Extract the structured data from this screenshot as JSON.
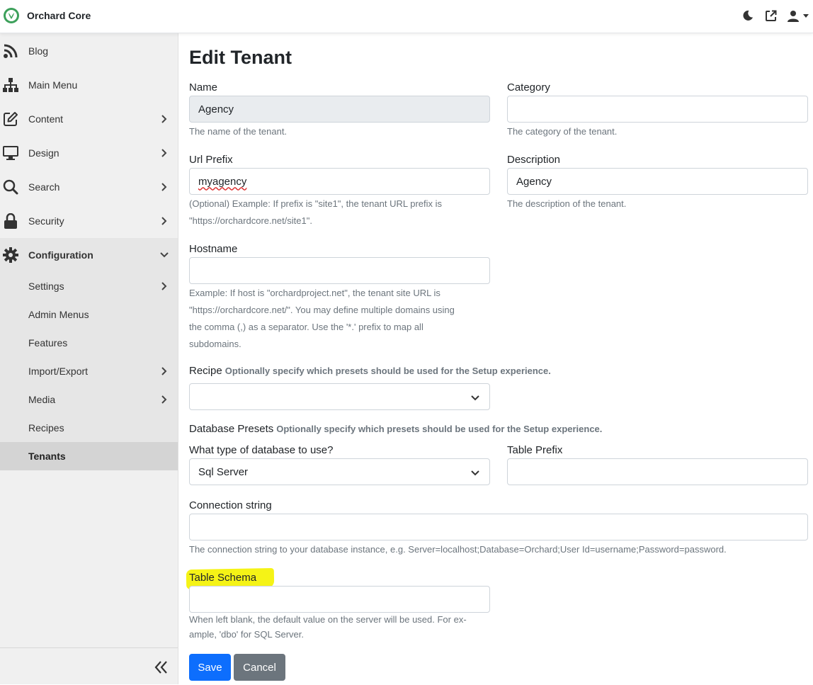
{
  "app": {
    "title": "Orchard Core"
  },
  "topbar": {
    "icons": [
      "moon-icon",
      "external-link-icon",
      "user-icon"
    ]
  },
  "sidebar": {
    "items": [
      {
        "label": "Blog",
        "icon": "rss-icon",
        "has_children": false
      },
      {
        "label": "Main Menu",
        "icon": "sitemap-icon",
        "has_children": false
      },
      {
        "label": "Content",
        "icon": "edit-icon",
        "has_children": true
      },
      {
        "label": "Design",
        "icon": "monitor-icon",
        "has_children": true
      },
      {
        "label": "Search",
        "icon": "search-icon",
        "has_children": true
      },
      {
        "label": "Security",
        "icon": "lock-icon",
        "has_children": true
      },
      {
        "label": "Configuration",
        "icon": "gear-icon",
        "has_children": true,
        "expanded": true
      }
    ],
    "subitems": [
      {
        "label": "Settings",
        "has_children": true
      },
      {
        "label": "Admin Menus",
        "has_children": false
      },
      {
        "label": "Features",
        "has_children": false
      },
      {
        "label": "Import/Export",
        "has_children": true
      },
      {
        "label": "Media",
        "has_children": true
      },
      {
        "label": "Recipes",
        "has_children": false
      },
      {
        "label": "Tenants",
        "has_children": false,
        "active": true
      }
    ]
  },
  "page": {
    "title": "Edit Tenant"
  },
  "form": {
    "name": {
      "label": "Name",
      "value": "Agency",
      "help": "The name of the tenant."
    },
    "category": {
      "label": "Category",
      "value": "",
      "help": "The category of the tenant."
    },
    "url_prefix": {
      "label": "Url Prefix",
      "value": "myagency",
      "help_line1": "(Optional) Example: If prefix is \"site1\", the tenant URL prefix is",
      "help_line2": "\"https://orchardcore.net/site1\"."
    },
    "description": {
      "label": "Description",
      "value": "Agency",
      "help": "The description of the tenant."
    },
    "hostname": {
      "label": "Hostname",
      "value": "",
      "help_lines": [
        "Example: If host is \"orchardproject.net\", the tenant site URL is",
        "\"https://orchardcore.net/\". You may define multiple domains using",
        "the comma (,) as a separator. Use the '*.' prefix to map all",
        "subdomains."
      ]
    },
    "recipe": {
      "label": "Recipe",
      "hint": "Optionally specify which presets should be used for the Setup experience.",
      "selected": ""
    },
    "database_presets": {
      "label": "Database Presets",
      "hint": "Optionally specify which presets should be used for the Setup experience."
    },
    "database_type": {
      "label": "What type of database to use?",
      "selected": "Sql Server"
    },
    "table_prefix": {
      "label": "Table Prefix",
      "value": ""
    },
    "connection_string": {
      "label": "Connection string",
      "value": "",
      "help": "The connection string to your database instance, e.g. Server=localhost;Database=Orchard;User Id=username;Password=password."
    },
    "table_schema": {
      "label": "Table Schema",
      "value": "",
      "highlight_color": "#f4f20a",
      "help_line1": "When left blank, the default value on the server will be used. For ex-",
      "help_line2": "ample, 'dbo' for SQL Server."
    }
  },
  "buttons": {
    "save": "Save",
    "cancel": "Cancel"
  },
  "colors": {
    "primary": "#0d6efd",
    "secondary": "#6c757d",
    "sidebar_bg": "#f0f0f0",
    "brand_green": "#3ca05a"
  }
}
